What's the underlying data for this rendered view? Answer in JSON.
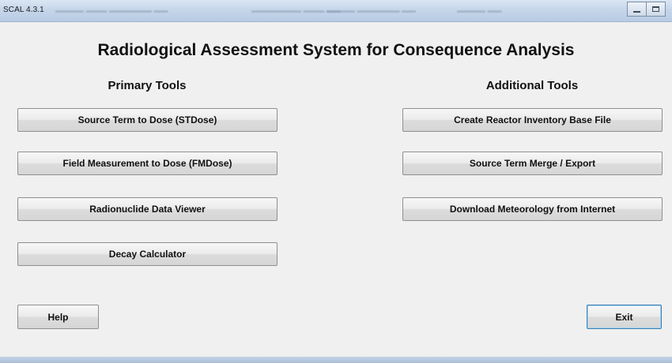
{
  "window": {
    "title": "SCAL 4.3.1"
  },
  "main": {
    "heading": "Radiological Assessment System for Consequence Analysis",
    "primary_tools": {
      "heading": "Primary Tools",
      "buttons": [
        "Source Term to Dose (STDose)",
        "Field Measurement to Dose (FMDose)",
        "Radionuclide Data Viewer",
        "Decay Calculator"
      ]
    },
    "additional_tools": {
      "heading": "Additional Tools",
      "buttons": [
        "Create Reactor Inventory Base File",
        "Source Term Merge / Export",
        "Download Meteorology from Internet"
      ]
    }
  },
  "footer": {
    "help_label": "Help",
    "exit_label": "Exit"
  },
  "colors": {
    "panel_background": "#f0f0f0",
    "title_bar": "#c6d6ea",
    "default_button_border": "#3c7fb1"
  },
  "icons": [
    "minimize-icon",
    "maximize-icon"
  ]
}
